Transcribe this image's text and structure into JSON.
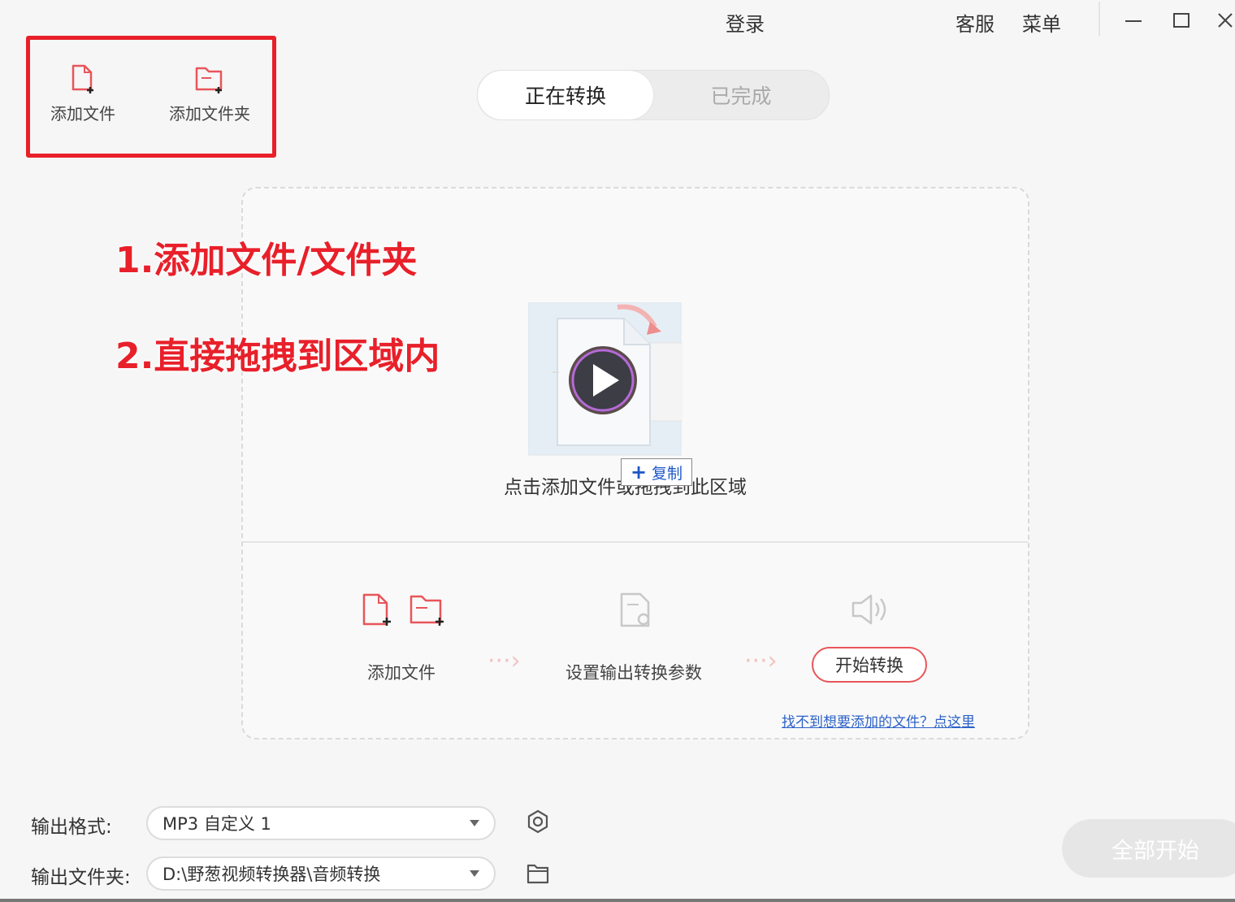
{
  "titlebar": {
    "login": "登录",
    "service": "客服",
    "menu": "菜单"
  },
  "toolbar": {
    "add_file": "添加文件",
    "add_folder": "添加文件夹"
  },
  "tabs": [
    {
      "label": "正在转换",
      "active": true
    },
    {
      "label": "已完成",
      "active": false
    }
  ],
  "annotations": {
    "step1": "1.添加文件/文件夹",
    "step2": "2.直接拖拽到区域内"
  },
  "dropzone": {
    "hint": "点击添加文件或拖拽到此区域",
    "copy_tooltip": "复制",
    "steps": {
      "add_file": "添加文件",
      "set_params": "设置输出转换参数",
      "start": "开始转换"
    },
    "help_link": "找不到想要添加的文件？点这里"
  },
  "output": {
    "format_label": "输出格式:",
    "format_value": "MP3 自定义 1",
    "folder_label": "输出文件夹:",
    "folder_value": "D:\\野葱视频转换器\\音频转换"
  },
  "actions": {
    "start_all": "全部开始"
  },
  "colors": {
    "accent": "#e8555a",
    "annotation_red": "#e8202a",
    "link_blue": "#2d62c8"
  }
}
